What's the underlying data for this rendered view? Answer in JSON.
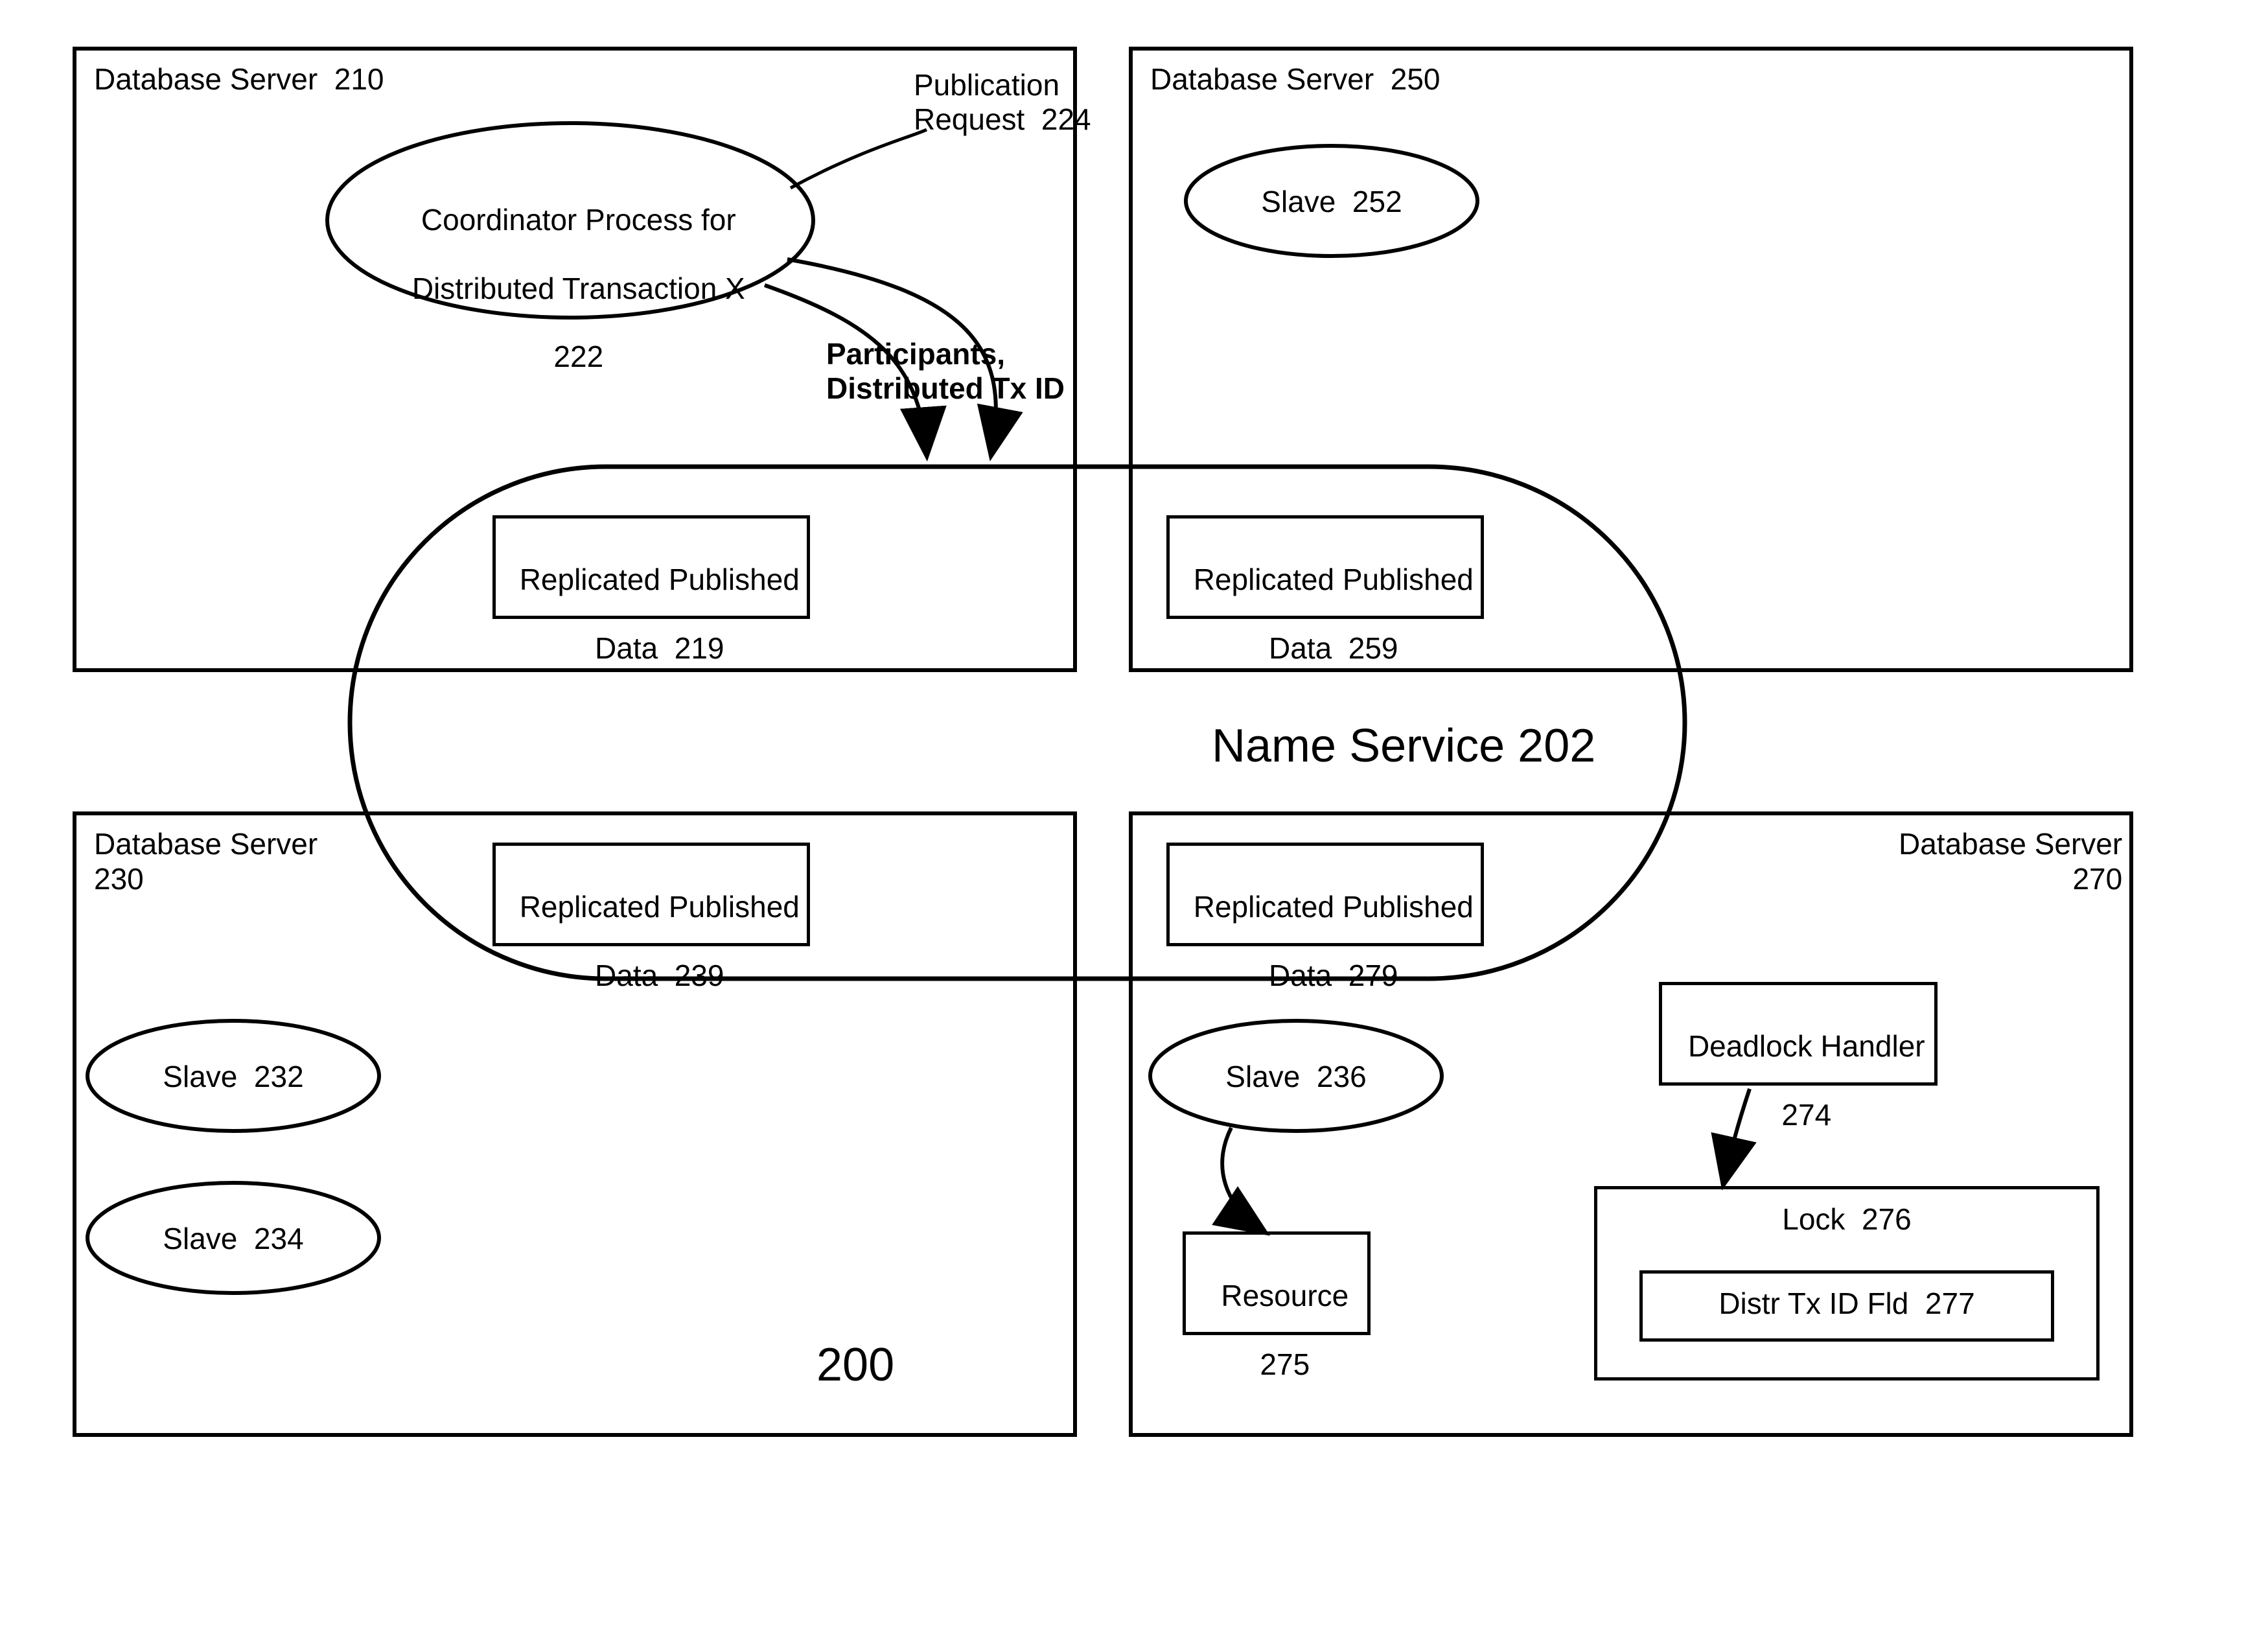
{
  "figure_id": "200",
  "name_service": {
    "label": "Name Service  202"
  },
  "publication_request": {
    "label": "Publication\nRequest  224"
  },
  "participants": {
    "label": "Participants,\nDistributed Tx ID"
  },
  "servers": {
    "s210": {
      "label": "Database Server  210"
    },
    "s230": {
      "label": "Database Server\n230"
    },
    "s250": {
      "label": "Database Server  250"
    },
    "s270": {
      "label": "Database Server\n270"
    }
  },
  "coordinator": {
    "line1": "Coordinator Process for",
    "line2": "Distributed Transaction X",
    "line3": "222"
  },
  "rpd": {
    "d219": {
      "line1": "Replicated Published",
      "line2": "Data  219"
    },
    "d239": {
      "line1": "Replicated Published",
      "line2": "Data  239"
    },
    "d259": {
      "line1": "Replicated Published",
      "line2": "Data  259"
    },
    "d279": {
      "line1": "Replicated Published",
      "line2": "Data  279"
    }
  },
  "slaves": {
    "sl232": "Slave  232",
    "sl234": "Slave  234",
    "sl236": "Slave  236",
    "sl252": "Slave  252"
  },
  "deadlock": {
    "line1": "Deadlock Handler",
    "line2": "274"
  },
  "lock": {
    "label": "Lock  276"
  },
  "distr_fld": {
    "label": "Distr Tx ID Fld  277"
  },
  "resource": {
    "line1": "Resource",
    "line2": "275"
  }
}
